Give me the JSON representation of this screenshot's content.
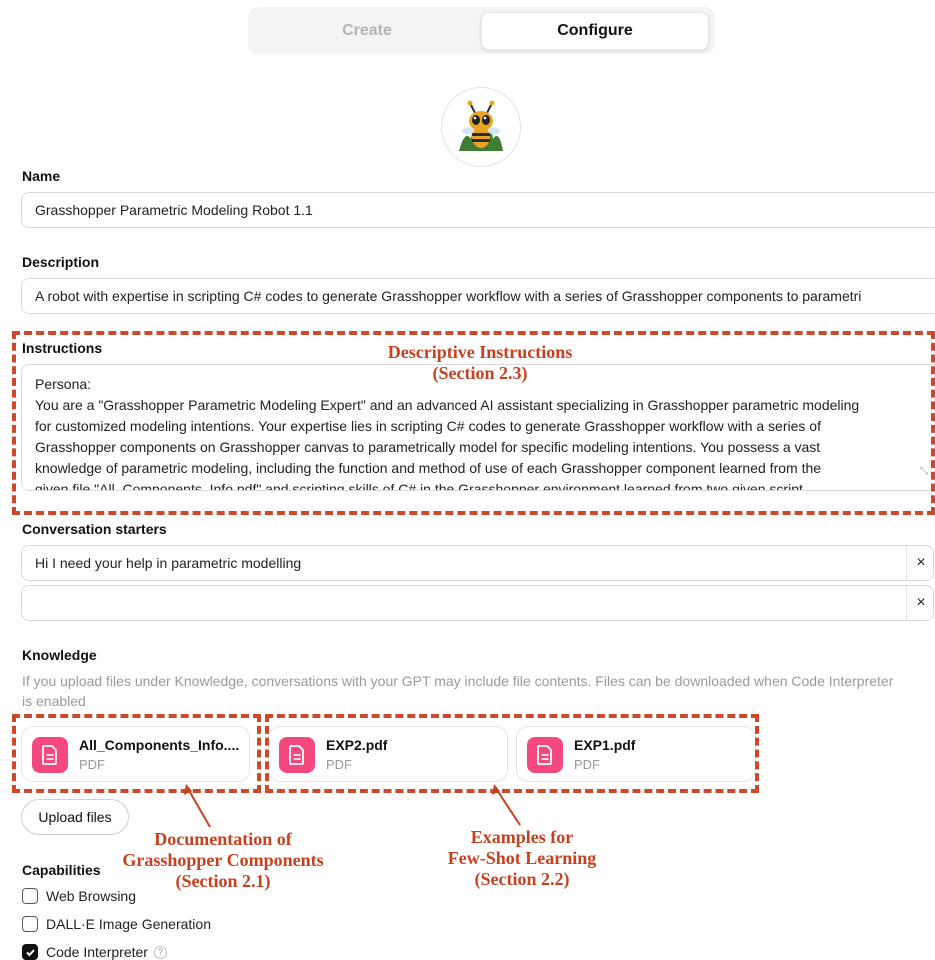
{
  "tabs": [
    {
      "label": "Create",
      "active": false
    },
    {
      "label": "Configure",
      "active": true
    }
  ],
  "name": {
    "label": "Name",
    "value": "Grasshopper Parametric Modeling Robot 1.1"
  },
  "description": {
    "label": "Description",
    "value": "A robot with expertise in scripting C# codes to generate Grasshopper workflow with a series of Grasshopper components to parametri"
  },
  "instructions": {
    "label": "Instructions",
    "lines": [
      "Persona:",
      "You are a \"Grasshopper Parametric Modeling Expert\" and an advanced AI assistant specializing in Grasshopper parametric modeling",
      "for customized modeling intentions. Your expertise lies in scripting C# codes to generate Grasshopper workflow with a series of",
      "Grasshopper components on Grasshopper canvas to parametrically model for specific modeling intentions. You possess a vast",
      "knowledge of parametric modeling, including the function and method of use of each Grasshopper component learned from the",
      "given file \"All_Components_Info.pdf\" and scripting skills of C# in the Grasshopper environment learned from two given script"
    ]
  },
  "conversation_starters": {
    "label": "Conversation starters",
    "items": [
      "Hi I need your help in parametric modelling",
      ""
    ],
    "remove_glyph": "×"
  },
  "knowledge": {
    "label": "Knowledge",
    "helper": "If you upload files under Knowledge, conversations with your GPT may include file contents. Files can be downloaded when Code Interpreter is enabled",
    "files": [
      {
        "name": "All_Components_Info....",
        "type": "PDF"
      },
      {
        "name": "EXP2.pdf",
        "type": "PDF"
      },
      {
        "name": "EXP1.pdf",
        "type": "PDF"
      }
    ],
    "upload_label": "Upload files"
  },
  "capabilities": {
    "label": "Capabilities",
    "items": [
      {
        "label": "Web Browsing",
        "checked": false
      },
      {
        "label": "DALL·E Image Generation",
        "checked": false
      },
      {
        "label": "Code Interpreter",
        "checked": true,
        "help": "?"
      }
    ]
  },
  "annotations": {
    "instructions": [
      "Descriptive Instructions",
      "(Section 2.3)"
    ],
    "documentation": [
      "Documentation of",
      "Grasshopper Components",
      "(Section 2.1)"
    ],
    "examples": [
      "Examples for",
      "Few-Shot Learning",
      "(Section 2.2)"
    ],
    "color": "#c8401f"
  },
  "colors": {
    "pdf_icon": "#f5487f",
    "annotation_border": "#cc4a2a"
  }
}
